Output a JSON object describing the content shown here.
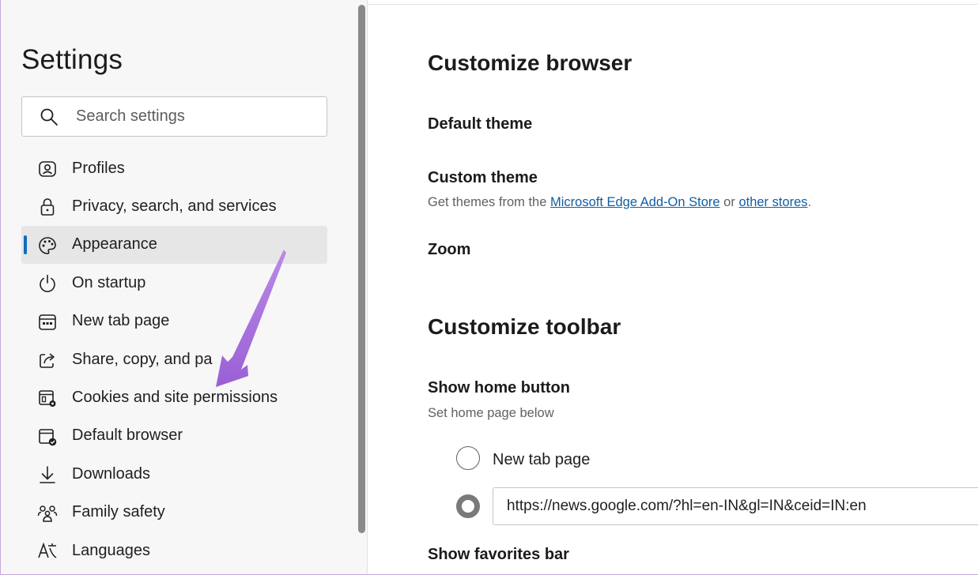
{
  "sidebar": {
    "title": "Settings",
    "search": {
      "placeholder": "Search settings",
      "value": ""
    },
    "items": [
      {
        "label": "Profiles",
        "icon": "profile-icon",
        "selected": false
      },
      {
        "label": "Privacy, search, and services",
        "icon": "lock-icon",
        "selected": false
      },
      {
        "label": "Appearance",
        "icon": "palette-icon",
        "selected": true
      },
      {
        "label": "On startup",
        "icon": "power-icon",
        "selected": false
      },
      {
        "label": "New tab page",
        "icon": "new-tab-icon",
        "selected": false
      },
      {
        "label": "Share, copy, and pa",
        "icon": "share-icon",
        "selected": false
      },
      {
        "label": "Cookies and site permissions",
        "icon": "cookies-settings-icon",
        "selected": false
      },
      {
        "label": "Default browser",
        "icon": "default-browser-icon",
        "selected": false
      },
      {
        "label": "Downloads",
        "icon": "download-icon",
        "selected": false
      },
      {
        "label": "Family safety",
        "icon": "family-icon",
        "selected": false
      },
      {
        "label": "Languages",
        "icon": "languages-icon",
        "selected": false
      }
    ]
  },
  "main": {
    "customize_browser": {
      "heading": "Customize browser",
      "default_theme": "Default theme",
      "custom_theme": "Custom theme",
      "custom_theme_desc_prefix": "Get themes from the ",
      "custom_theme_link1": "Microsoft Edge Add-On Store",
      "custom_theme_desc_mid": " or ",
      "custom_theme_link2": "other stores",
      "custom_theme_desc_suffix": ".",
      "zoom": "Zoom"
    },
    "customize_toolbar": {
      "heading": "Customize toolbar",
      "show_home_button": "Show home button",
      "show_home_desc": "Set home page below",
      "option_new_tab": "New tab page",
      "home_url": "https://news.google.com/?hl=en-IN&gl=IN&ceid=IN:en",
      "show_favorites_bar": "Show favorites bar"
    }
  },
  "colors": {
    "accent": "#0f6cbd",
    "link": "#115ea3",
    "annotation_arrow": "#a66ad9"
  }
}
